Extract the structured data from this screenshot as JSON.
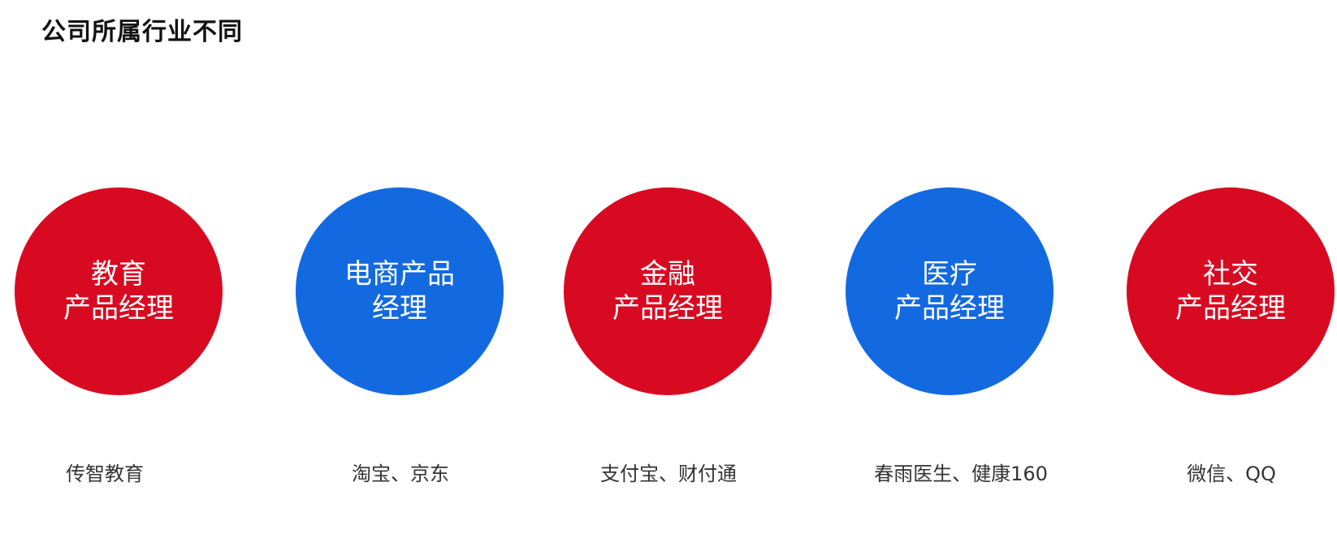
{
  "title": "公司所属行业不同",
  "colors": {
    "red": "#d80a21",
    "blue": "#136ae0"
  },
  "industries": [
    {
      "line1": "教育",
      "line2": "产品经理",
      "caption": "传智教育",
      "color": "red"
    },
    {
      "line1": "电商产品",
      "line2": "经理",
      "caption": "淘宝、京东",
      "color": "blue"
    },
    {
      "line1": "金融",
      "line2": "产品经理",
      "caption": "支付宝、财付通",
      "color": "red"
    },
    {
      "line1": "医疗",
      "line2": "产品经理",
      "caption": "春雨医生、健康160",
      "color": "blue"
    },
    {
      "line1": "社交",
      "line2": "产品经理",
      "caption": "微信、QQ",
      "color": "red"
    }
  ]
}
